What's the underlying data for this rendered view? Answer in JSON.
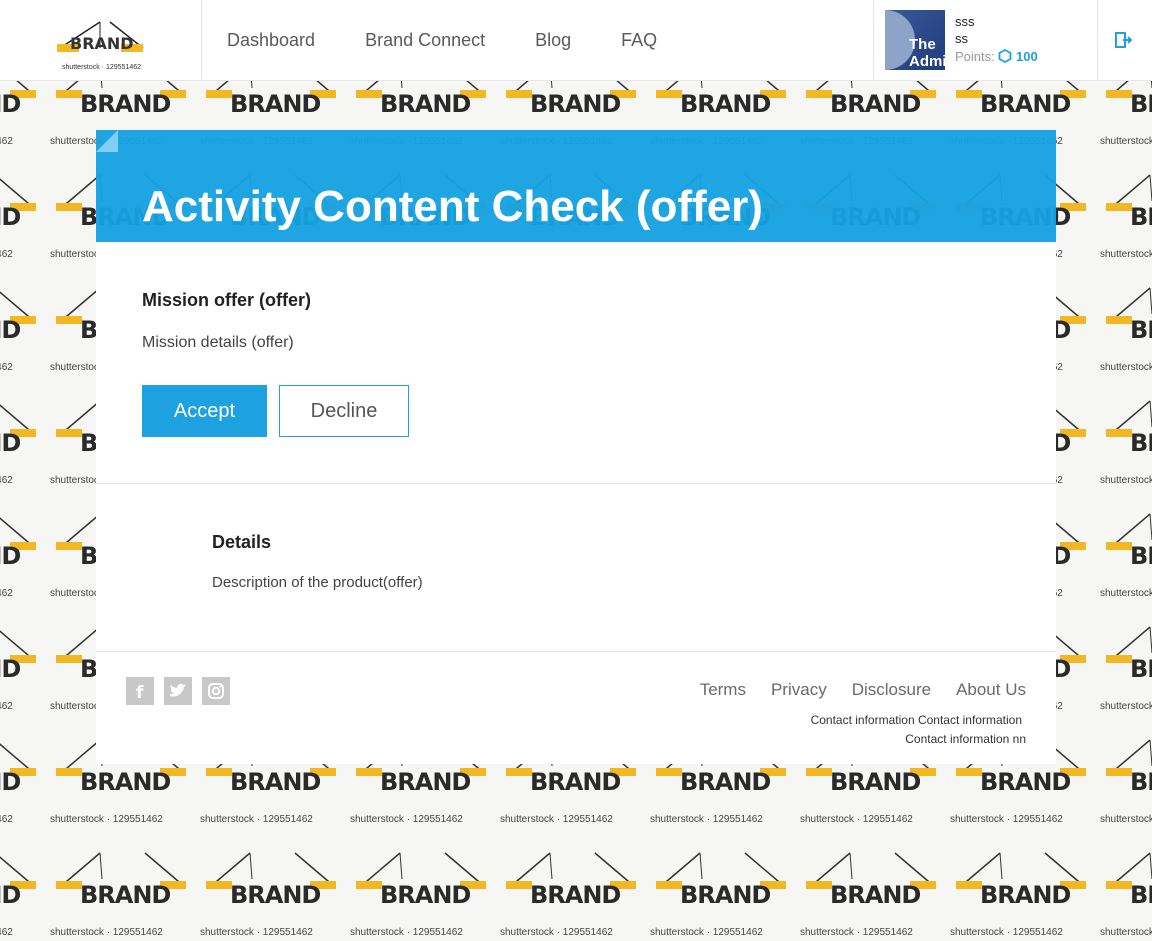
{
  "header": {
    "logo_text": "BRAND",
    "logo_watermark": "shutterstock · 129551462",
    "nav": [
      "Dashboard",
      "Brand Connect",
      "Blog",
      "FAQ"
    ],
    "user": {
      "avatar_text": "The Admi",
      "line1": "sss",
      "line2": "ss",
      "points_label": "Points:",
      "points_value": "100"
    },
    "logout_icon": "logout-icon"
  },
  "background": {
    "brand_text": "BRAND",
    "watermark": "shutterstock · 129551462"
  },
  "banner": {
    "title": "Activity Content Check (offer)"
  },
  "mission": {
    "title": "Mission offer (offer)",
    "details": "Mission details (offer)",
    "accept_label": "Accept",
    "decline_label": "Decline"
  },
  "details": {
    "title": "Details",
    "description": "Description of the product(offer)"
  },
  "footer": {
    "social": [
      "facebook-icon",
      "twitter-icon",
      "instagram-icon"
    ],
    "links": [
      "Terms",
      "Privacy",
      "Disclosure",
      "About Us"
    ],
    "contact_line1": "Contact information Contact information",
    "contact_line2": "Contact information nn"
  },
  "colors": {
    "accent": "#1da1e0",
    "banner": "#17a1e2"
  }
}
